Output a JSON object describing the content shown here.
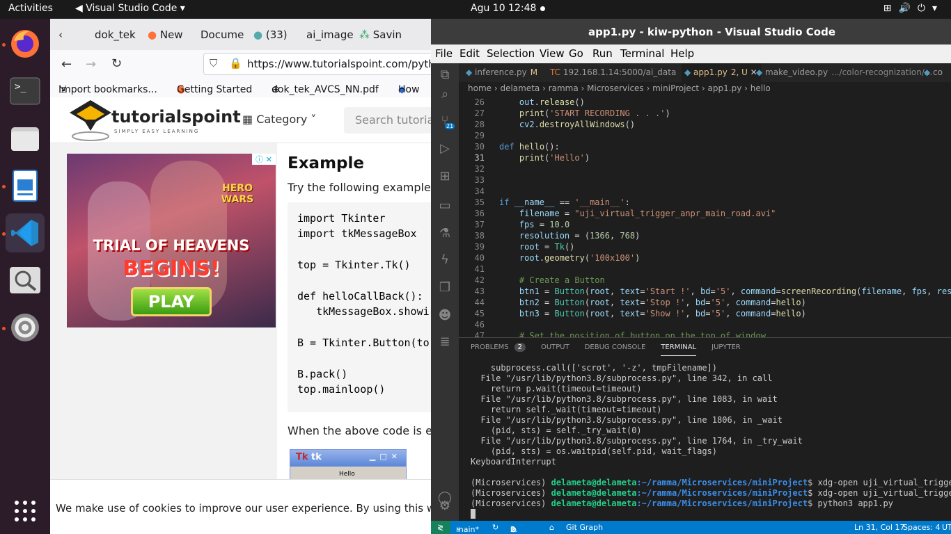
{
  "topbar": {
    "activities": "Activities",
    "app": "Visual Studio Code",
    "clock": "Agu 10  12:48"
  },
  "dock": {
    "items": [
      "firefox-icon",
      "terminal-icon",
      "files-icon",
      "writer-icon",
      "vscode-icon",
      "screenshot-icon",
      "settings-icon",
      "apps-grid-icon"
    ]
  },
  "firefox": {
    "tabs": [
      "dok_tek",
      "New",
      "Docume",
      "(33)",
      "ai_image",
      "Savin"
    ],
    "url_domain": "https://www.tutorialspoint.com/pytho",
    "bookmarks": [
      "Import bookmarks...",
      "Getting Started",
      "dok_tek_AVCS_NN.pdf",
      "How"
    ],
    "logo_text": "tutorialspoint",
    "logo_sub": "SIMPLY EASY LEARNING",
    "category": "Category",
    "search_placeholder": "Search tutorials",
    "ad": {
      "title1": "TRIAL OF HEAVENS",
      "title2": "BEGINS!",
      "button": "PLAY",
      "brand": "HERO WARS"
    },
    "heading": "Example",
    "intro": "Try the following example",
    "code": [
      "import Tkinter",
      "import tkMessageBox",
      "",
      "top = Tkinter.Tk()",
      "",
      "def helloCallBack():",
      "   tkMessageBox.showi",
      "",
      "B = Tkinter.Button(to",
      "",
      "B.pack()",
      "top.mainloop()"
    ],
    "after": "When the above code is e",
    "tkwin": {
      "title": "tk",
      "button": "Hello"
    },
    "cookie": "We make use of cookies to improve our user experience. By using this websi"
  },
  "vscode": {
    "title": "app1.py - kiw-python - Visual Studio Code",
    "menu": [
      "File",
      "Edit",
      "Selection",
      "View",
      "Go",
      "Run",
      "Terminal",
      "Help"
    ],
    "scm_badge": "21",
    "tabs": [
      {
        "label": "inference.py",
        "extra": "M"
      },
      {
        "label": "192.168.1.14:5000/ai_data",
        "extra": ""
      },
      {
        "label": "app1.py",
        "extra": "2, U"
      },
      {
        "label": "make_video.py",
        "extra": ".../color-recognization/..."
      },
      {
        "label": "co",
        "extra": ""
      }
    ],
    "breadcrumb": "home › delameta › ramma › Microservices › miniProject › app1.py › hello",
    "lines": [
      "26",
      "27",
      "28",
      "29",
      "30",
      "31",
      "32",
      "33",
      "34",
      "35",
      "36",
      "37",
      "38",
      "39",
      "40",
      "41",
      "42",
      "43",
      "44",
      "45",
      "46",
      "47"
    ],
    "panel_tabs": [
      "PROBLEMS",
      "OUTPUT",
      "DEBUG CONSOLE",
      "TERMINAL",
      "JUPYTER"
    ],
    "problems_count": "2",
    "terminal": [
      "    subprocess.call(['scrot', '-z', tmpFilename])",
      "  File \"/usr/lib/python3.8/subprocess.py\", line 342, in call",
      "    return p.wait(timeout=timeout)",
      "  File \"/usr/lib/python3.8/subprocess.py\", line 1083, in wait",
      "    return self._wait(timeout=timeout)",
      "  File \"/usr/lib/python3.8/subprocess.py\", line 1806, in _wait",
      "    (pid, sts) = self._try_wait(0)",
      "  File \"/usr/lib/python3.8/subprocess.py\", line 1764, in _try_wait",
      "    (pid, sts) = os.waitpid(self.pid, wait_flags)",
      "KeyboardInterrupt"
    ],
    "prompt_env": "(Microservices)",
    "prompt_user": "delameta@delameta",
    "prompt_path": ":~/ramma/Microservices/miniProject",
    "cmds": [
      "$ xdg-open uji_virtual_trigger_a",
      "$ xdg-open uji_virtual_trigger_a",
      "$ python3 app1.py"
    ],
    "status": {
      "branch": "main*",
      "errors": "0",
      "warnings": "2",
      "git_graph": "Git Graph",
      "position": "Ln 31, Col 17",
      "spaces": "Spaces: 4",
      "enc": "UT"
    }
  }
}
